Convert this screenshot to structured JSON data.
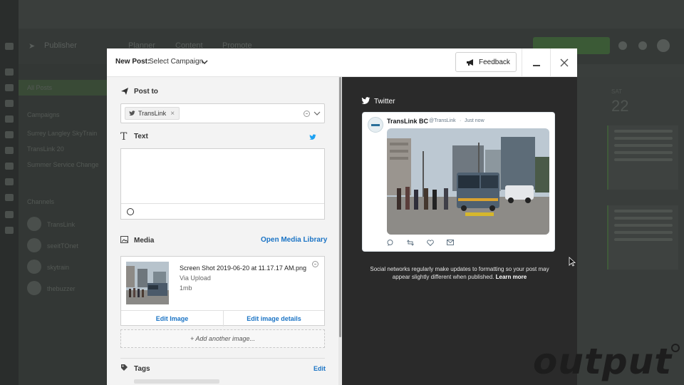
{
  "background_app": {
    "title": "Publisher",
    "tabs": [
      "Planner",
      "Content",
      "Promote"
    ],
    "sidebar": [
      "All Posts",
      "Campaigns",
      "Surrey Langley SkyTrain",
      "TransLink 20",
      "Summer Service Change",
      "Channels",
      "TransLink",
      "seeitTOnet",
      "skytrain",
      "thebuzzer"
    ],
    "calendar_day_of_week": "SAT",
    "calendar_day": "22"
  },
  "modal": {
    "new_post_label": "New Post:",
    "campaign_select": "Select Campaign",
    "feedback_label": "Feedback",
    "compose": {
      "post_to_title": "Post to",
      "profile_chip": "TransLink",
      "chip_remove": "×",
      "text_title": "Text",
      "text_value": "",
      "media_title": "Media",
      "open_media_library": "Open Media Library",
      "media_item": {
        "file_name": "Screen Shot 2019-06-20 at 11.17.17 AM.png",
        "source": "Via Upload",
        "size": "1mb"
      },
      "edit_image": "Edit Image",
      "edit_image_details": "Edit image details",
      "add_another_image": "+ Add another image...",
      "tags_title": "Tags",
      "tags_edit": "Edit"
    },
    "preview": {
      "network_title": "Twitter",
      "tweet": {
        "display_name": "TransLink BC",
        "handle": "@TransLink",
        "dot": "·",
        "time": "Just now"
      },
      "note_text": "Social networks regularly make updates to formatting so your post may appear slightly different when published.",
      "note_link": "Learn more"
    }
  },
  "watermark": "output",
  "colors": {
    "link_blue": "#1b74c5",
    "twitter_blue": "#1da1f2",
    "preview_bg": "#2a2a2a"
  }
}
